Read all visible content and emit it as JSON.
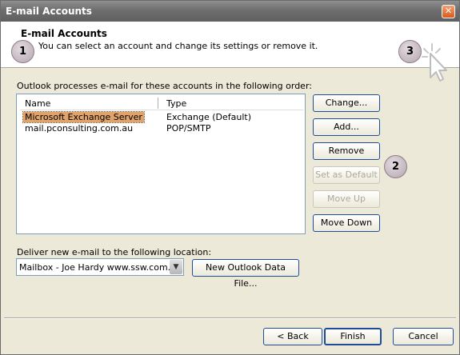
{
  "window": {
    "title": "E-mail Accounts",
    "close_glyph": "✕"
  },
  "header": {
    "title": "E-mail Accounts",
    "subtitle": "You can select an account and change its settings or remove it."
  },
  "badges": {
    "one": "1",
    "two": "2",
    "three": "3"
  },
  "accounts": {
    "label": "Outlook processes e-mail for these accounts in the following order:",
    "columns": {
      "name": "Name",
      "type": "Type"
    },
    "rows": [
      {
        "name": "Microsoft Exchange Server",
        "type": "Exchange (Default)",
        "selected": true
      },
      {
        "name": "mail.pconsulting.com.au",
        "type": "POP/SMTP",
        "selected": false
      }
    ]
  },
  "buttons": {
    "change": "Change...",
    "add": "Add...",
    "remove": "Remove",
    "set_default": "Set as Default",
    "move_up": "Move Up",
    "move_down": "Move Down"
  },
  "delivery": {
    "label": "Deliver new e-mail to the following location:",
    "selected_location": "Mailbox - Joe Hardy www.ssw.com.au",
    "new_data_file": "New Outlook Data File..."
  },
  "footer": {
    "back": "< Back",
    "finish": "Finish",
    "cancel": "Cancel"
  },
  "icons": {
    "close": "close-icon",
    "cursor": "cursor-click-icon",
    "dropdown": "chevron-down-icon"
  }
}
